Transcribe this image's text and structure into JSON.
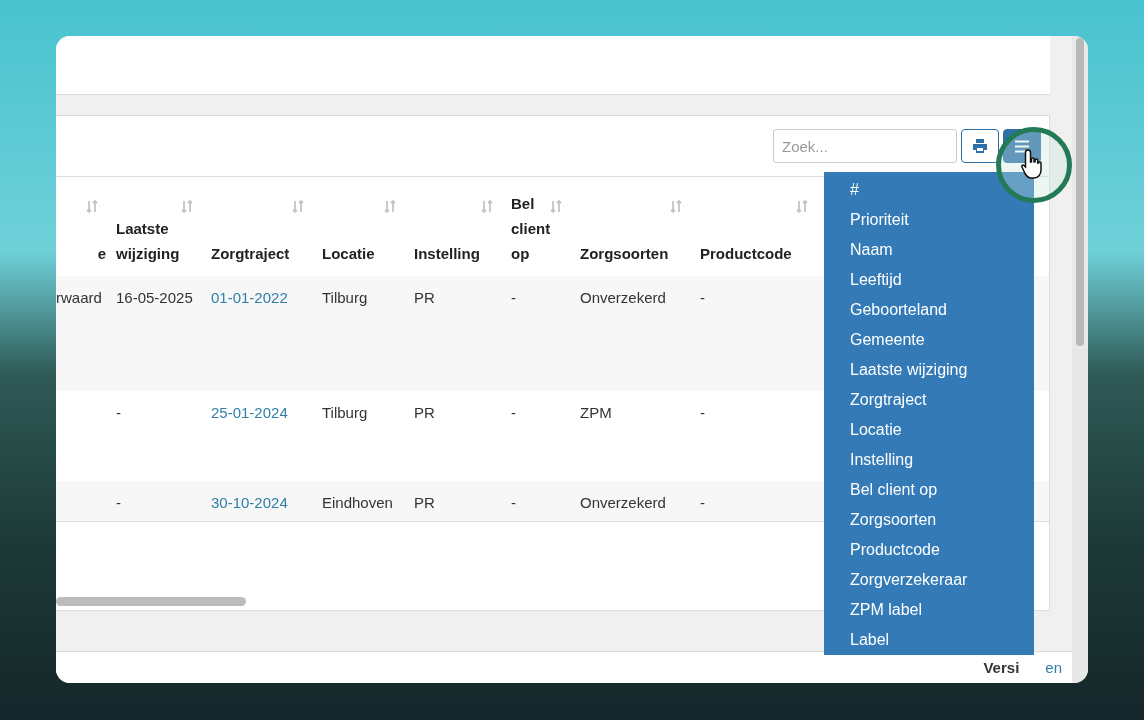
{
  "toolbar": {
    "search": {
      "placeholder": "Zoek..."
    },
    "column_menu_open": true
  },
  "table": {
    "columns": [
      {
        "label": "e",
        "kind": "text"
      },
      {
        "label": "Laatste wijziging",
        "kind": "text"
      },
      {
        "label": "Zorgtraject",
        "kind": "link"
      },
      {
        "label": "Locatie",
        "kind": "text"
      },
      {
        "label": "Instelling",
        "kind": "text"
      },
      {
        "label": "Bel client op",
        "kind": "text"
      },
      {
        "label": "Zorgsoorten",
        "kind": "text"
      },
      {
        "label": "Productcode",
        "kind": "text"
      }
    ],
    "rows": [
      [
        "rwaard",
        "16-05-2025",
        "01-01-2022",
        "Tilburg",
        "PR",
        "-",
        "Onverzekerd",
        "-"
      ],
      [
        "",
        "-",
        "25-01-2024",
        "Tilburg",
        "PR",
        "-",
        "ZPM",
        "-"
      ],
      [
        "",
        "-",
        "30-10-2024",
        "Eindhoven",
        "PR",
        "-",
        "Onverzekerd",
        "-"
      ]
    ]
  },
  "column_menu": {
    "items": [
      "#",
      "Prioriteit",
      "Naam",
      "Leeftijd",
      "Geboorteland",
      "Gemeente",
      "Laatste wijziging",
      "Zorgtraject",
      "Locatie",
      "Instelling",
      "Bel client op",
      "Zorgsoorten",
      "Productcode",
      "Zorgverzekeraar",
      "ZPM label",
      "Label"
    ]
  },
  "footer": {
    "version_label": "Versi",
    "link": "en"
  }
}
